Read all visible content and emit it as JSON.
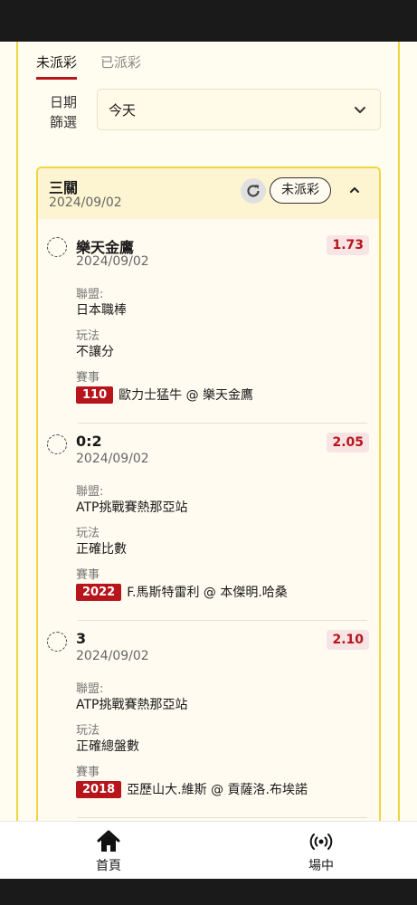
{
  "tabs": [
    {
      "label": "未派彩",
      "active": true
    },
    {
      "label": "已派彩",
      "active": false
    }
  ],
  "filter": {
    "label": "日期\n篩選",
    "value": "今天"
  },
  "bet": {
    "title": "三關",
    "date": "2024/09/02",
    "status": "未派彩",
    "legs": [
      {
        "title": "樂天金鷹",
        "date": "2024/09/02",
        "odds": "1.73",
        "league_label": "聯盟:",
        "league": "日本職棒",
        "play_label": "玩法",
        "play": "不讓分",
        "event_label": "賽事",
        "code": "110",
        "match": "歐力士猛牛 @ 樂天金鷹"
      },
      {
        "title": "0:2",
        "date": "2024/09/02",
        "odds": "2.05",
        "league_label": "聯盟:",
        "league": "ATP挑戰賽熱那亞站",
        "play_label": "玩法",
        "play": "正確比數",
        "event_label": "賽事",
        "code": "2022",
        "match": "F.馬斯特雷利 @ 本傑明.哈桑"
      },
      {
        "title": "3",
        "date": "2024/09/02",
        "odds": "2.10",
        "league_label": "聯盟:",
        "league": "ATP挑戰賽熱那亞站",
        "play_label": "玩法",
        "play": "正確總盤數",
        "event_label": "賽事",
        "code": "2018",
        "match": "亞歷山大.維斯 @ 貢薩洛.布埃諾"
      }
    ]
  },
  "nav": [
    {
      "label": "首頁",
      "icon": "home-icon"
    },
    {
      "label": "場中",
      "icon": "live-broadcast-icon"
    }
  ],
  "colors": {
    "accent": "#b7141b",
    "frame": "#f0d443",
    "header_bg": "#fdf5d1"
  }
}
